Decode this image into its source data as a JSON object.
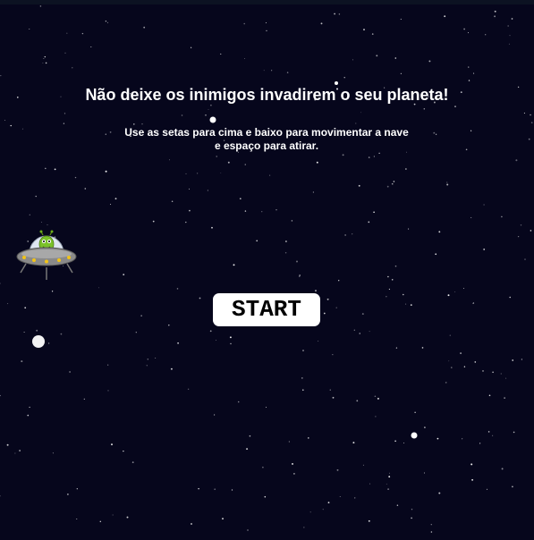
{
  "game": {
    "title": "Não deixe os inimigos invadirem o seu planeta!",
    "instructions_line1": "Use as setas para cima e baixo para movimentar a nave",
    "instructions_line2": "e espaço para atirar.",
    "start_label": "START",
    "player_ship_icon": "ufo-alien-icon"
  },
  "colors": {
    "background": "#06061c",
    "text": "#ffffff",
    "button_bg": "#ffffff",
    "button_text": "#000000"
  }
}
